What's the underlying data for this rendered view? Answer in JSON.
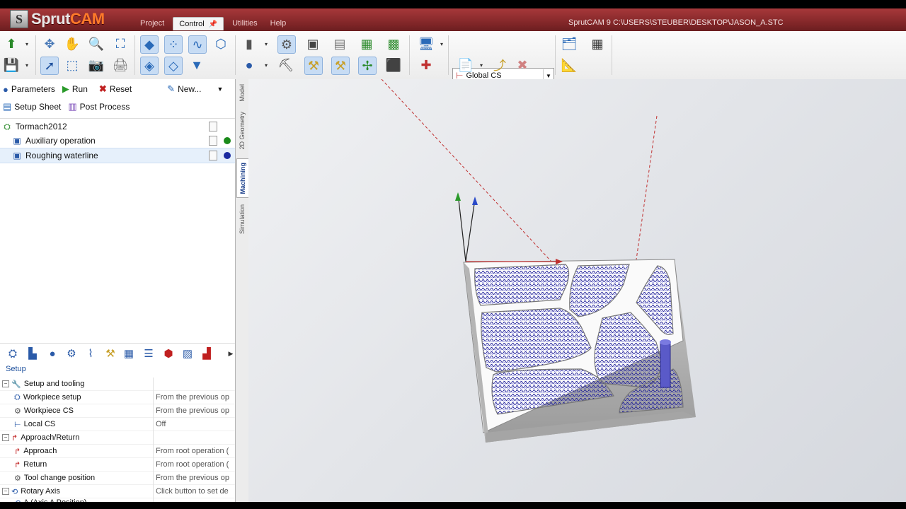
{
  "app": {
    "logo_letter": "S",
    "logo_prefix": "Sprut",
    "logo_suffix": "CAM",
    "window_title": "SprutCAM 9  C:\\USERS\\STEUBER\\DESKTOP\\JASON_A.STC"
  },
  "menu_tabs": [
    {
      "label": "Project"
    },
    {
      "label": "Control"
    },
    {
      "label": "Utilities"
    },
    {
      "label": "Help"
    }
  ],
  "toolbar": {
    "cs_select": "Global CS"
  },
  "actions": {
    "parameters": "Parameters",
    "run": "Run",
    "reset": "Reset",
    "new": "New...",
    "setup_sheet": "Setup Sheet",
    "post_process": "Post Process"
  },
  "tree": [
    {
      "label": "Tormach2012"
    },
    {
      "label": "Auxiliary operation"
    },
    {
      "label": "Roughing waterline"
    }
  ],
  "side_tabs": [
    "Model",
    "2D Geometry",
    "Machining",
    "Simulation"
  ],
  "setup_label": "Setup",
  "props": [
    {
      "name": "Setup and tooling",
      "value": ""
    },
    {
      "name": "Workpiece setup",
      "value": "From the previous op"
    },
    {
      "name": "Workpiece CS",
      "value": "From the previous op"
    },
    {
      "name": "Local CS",
      "value": "Off"
    },
    {
      "name": "Approach/Return",
      "value": ""
    },
    {
      "name": "Approach",
      "value": "From root operation ("
    },
    {
      "name": "Return",
      "value": "From root operation ("
    },
    {
      "name": "Tool change position",
      "value": "From the previous op"
    },
    {
      "name": "Rotary Axis",
      "value": "Click button to set de"
    },
    {
      "name": "A (Axis A Position)",
      "value": ""
    }
  ],
  "colors": {
    "titlebar": "#8b2a2c",
    "accent_blue": "#1c4f9c",
    "toolpath": "#1a1a9a",
    "status_green": "#1a8a1a",
    "status_blue": "#1a2aa0"
  }
}
